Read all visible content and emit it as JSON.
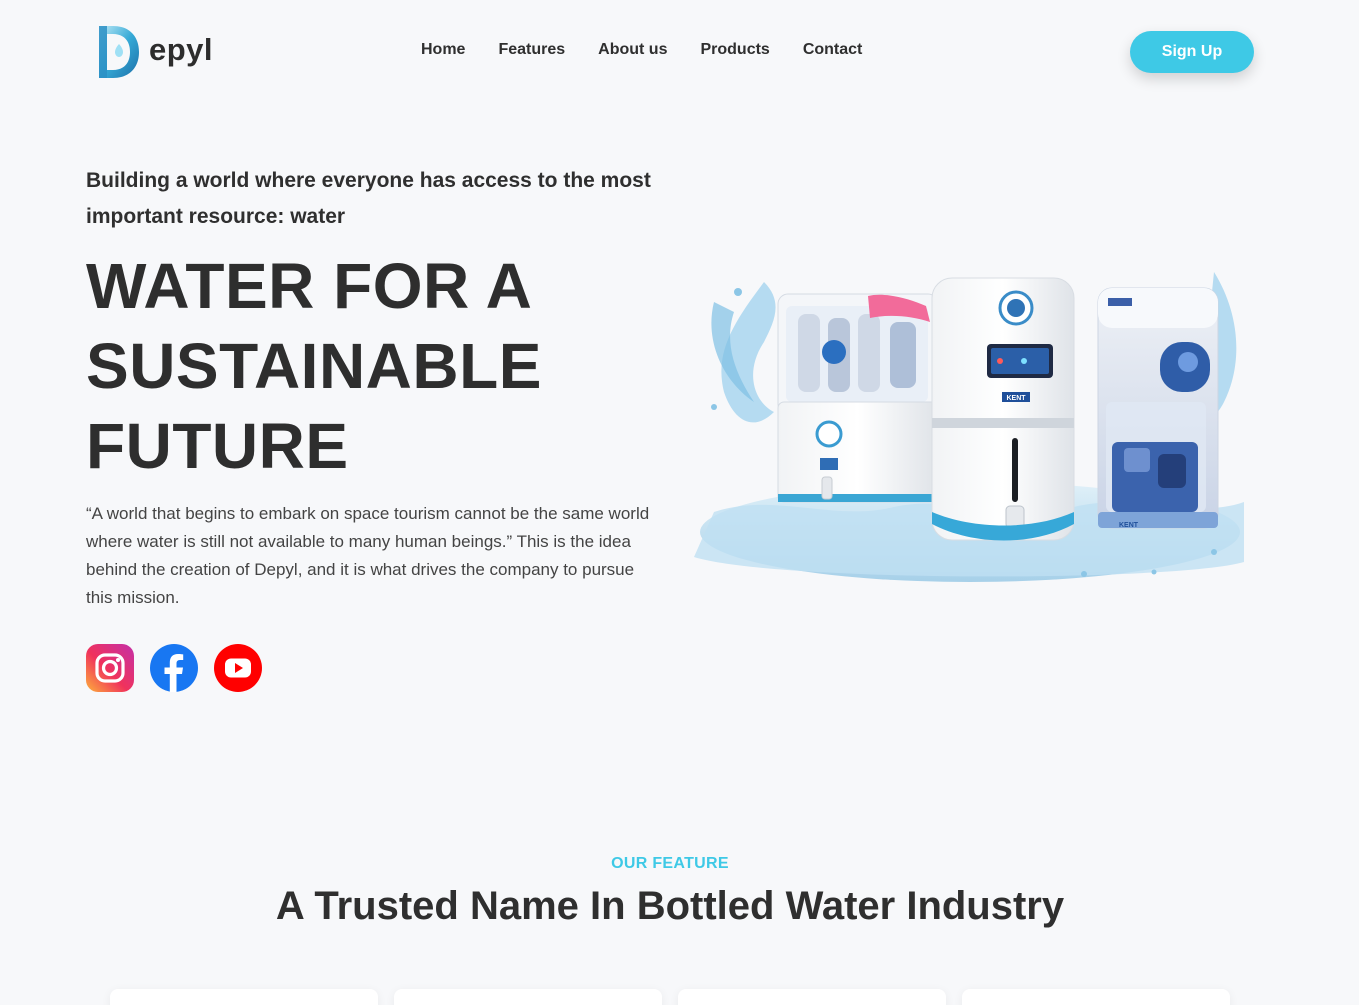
{
  "brand": {
    "name": "epyl",
    "logo_letter": "D"
  },
  "nav": {
    "items": [
      {
        "label": "Home"
      },
      {
        "label": "Features"
      },
      {
        "label": "About us"
      },
      {
        "label": "Products"
      },
      {
        "label": "Contact"
      }
    ],
    "signup_label": "Sign Up"
  },
  "hero": {
    "tagline": "Building a world where everyone has access to the most important resource: water",
    "title_lines": [
      "WATER FOR A",
      "SUSTAINABLE",
      "FUTURE"
    ],
    "description": "“A world that begins to embark on space tourism cannot be the same world where water is still not available to many human beings.” This is the idea behind the creation of Depyl, and it is what drives the company to pursue this mission.",
    "image": "water-purifiers-illustration",
    "product_labels": [
      "KENT",
      "KENT"
    ]
  },
  "social": [
    {
      "icon": "instagram-icon",
      "color": "#e1306c"
    },
    {
      "icon": "facebook-icon",
      "color": "#1877f2"
    },
    {
      "icon": "youtube-icon",
      "color": "#ff0000"
    }
  ],
  "features": {
    "kicker": "OUR FEATURE",
    "title": "A Trusted Name In Bottled Water Industry"
  },
  "colors": {
    "accent": "#3ec9e6",
    "background": "#f7f8fa",
    "text": "#2f2f2f"
  }
}
